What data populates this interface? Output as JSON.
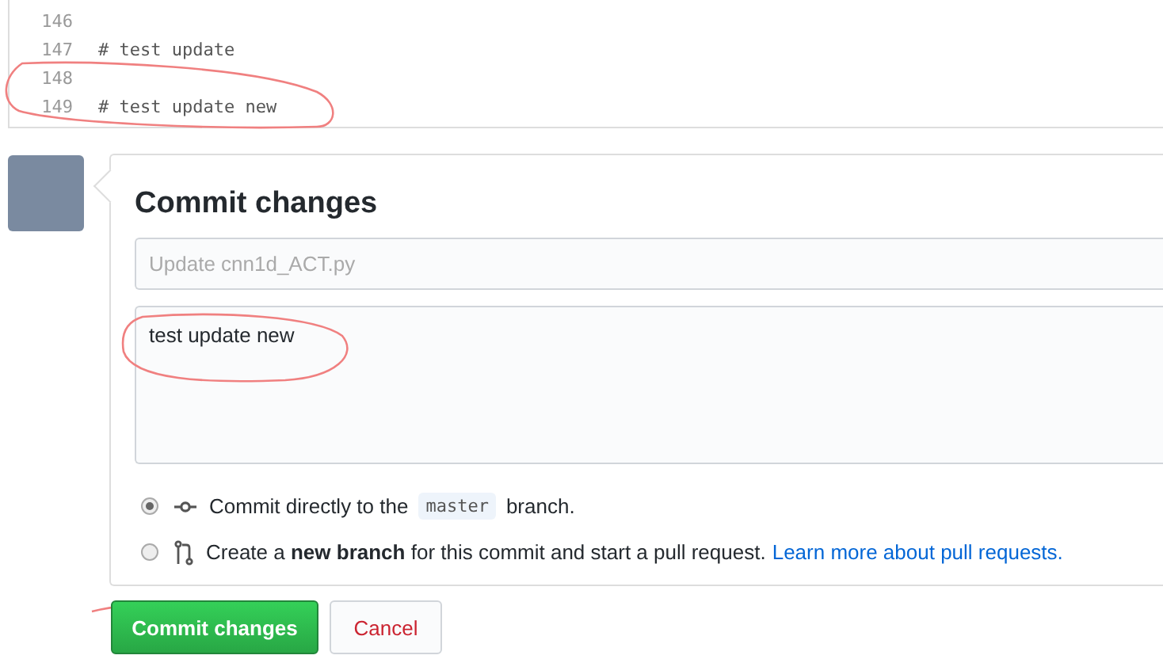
{
  "code_lines": [
    {
      "number": "146"
    },
    {
      "number": "147",
      "text": "# test update"
    },
    {
      "number": "148"
    },
    {
      "number": "149",
      "text": "# test update new"
    }
  ],
  "commit_form": {
    "title": "Commit changes",
    "summary": {
      "placeholder": "Update cnn1d_ACT.py"
    },
    "description": {
      "value": "test update new"
    },
    "options": [
      {
        "kind": "direct",
        "selected": true,
        "text_before": "Commit directly to the",
        "branch": "master",
        "text_after": "branch."
      },
      {
        "kind": "new_branch",
        "selected": false,
        "text": "Create a **new branch** for this commit and start a pull request.",
        "link": "Learn more about pull requests."
      }
    ]
  },
  "buttons": [
    {
      "kind": "primary",
      "label": "Commit changes"
    },
    {
      "kind": "cancel",
      "label": "Cancel"
    }
  ]
}
